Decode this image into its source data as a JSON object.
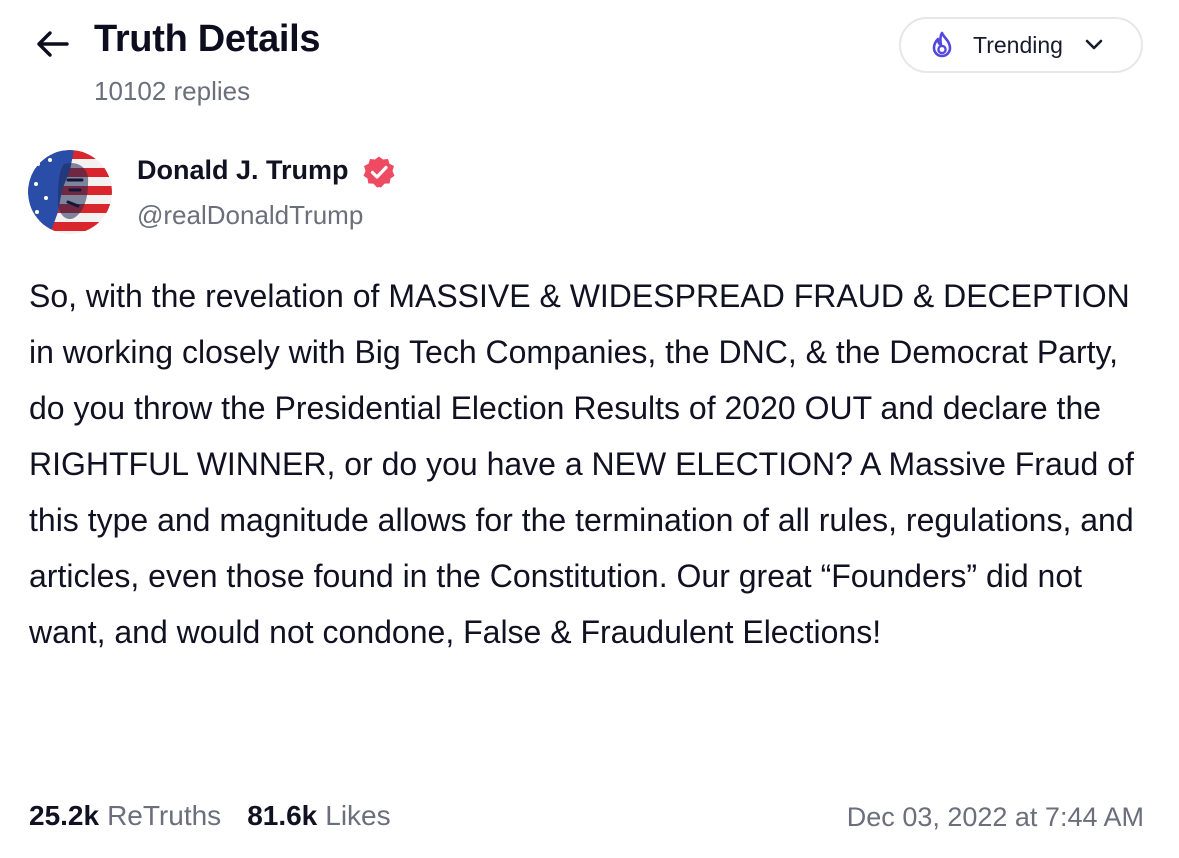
{
  "header": {
    "title": "Truth Details",
    "reply_count": "10102 replies",
    "back_icon": "arrow-left-icon"
  },
  "feed_filter": {
    "label": "Trending",
    "icon": "flame-icon",
    "accent_color": "#5548e0"
  },
  "post": {
    "author": {
      "name": "Donald J. Trump",
      "handle": "@realDonaldTrump",
      "verified": true,
      "verified_color": "#ee4b62"
    },
    "text": "So, with the revelation of MASSIVE & WIDESPREAD FRAUD & DECEPTION in working closely with Big Tech Companies, the DNC, & the Democrat Party, do you throw the Presidential Election Results of 2020 OUT and declare the RIGHTFUL WINNER, or do you have a NEW ELECTION? A Massive Fraud of this type and magnitude allows for the termination of all rules, regulations, and articles, even those found in the Constitution. Our great “Founders” did not want, and would not condone, False & Fraudulent Elections!",
    "stats": {
      "retruths_count": "25.2k",
      "retruths_label": "ReTruths",
      "likes_count": "81.6k",
      "likes_label": "Likes"
    },
    "timestamp": "Dec 03, 2022 at 7:44 AM"
  }
}
